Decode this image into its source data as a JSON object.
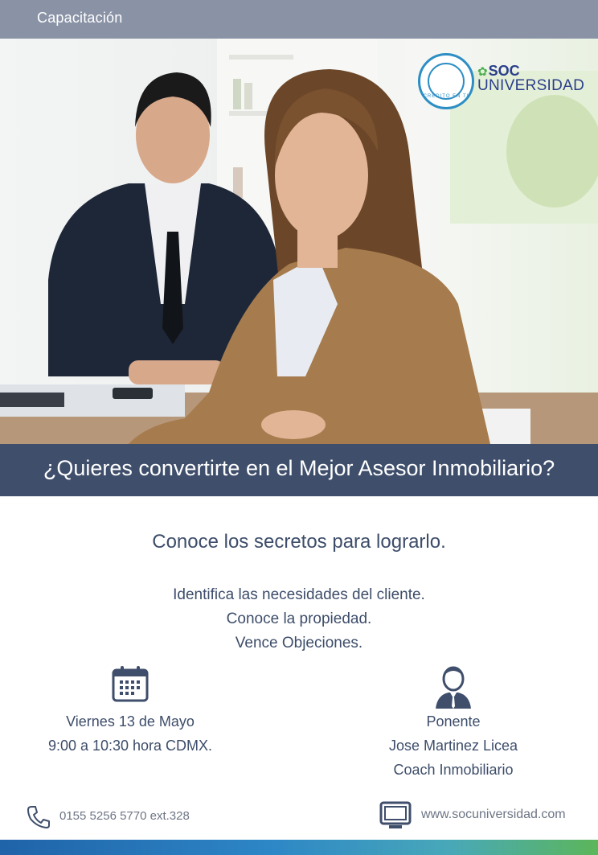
{
  "header": {
    "label": "Capacitación"
  },
  "logo": {
    "brand": "SOC",
    "sub": "UNIVERSIDAD",
    "seal_text": "CRÉDITO EN TI"
  },
  "headline": "¿Quieres convertirte en el Mejor Asesor Inmobiliario?",
  "subtitle": "Conoce los secretos para lograrlo.",
  "bullets": [
    "Identifica las necesidades del cliente.",
    "Conoce la propiedad.",
    "Vence Objeciones."
  ],
  "event": {
    "icon": "calendar-icon",
    "date": "Viernes 13 de Mayo",
    "time": "9:00 a 10:30 hora CDMX."
  },
  "speaker": {
    "icon": "person-icon",
    "title": "Ponente",
    "name": "Jose Martinez Licea",
    "role": "Coach Inmobiliario"
  },
  "contact": {
    "phone": "0155 5256 5770 ext.328",
    "website": "www.socuniversidad.com"
  },
  "colors": {
    "topbar": "#8a93a6",
    "headline_bar": "#3f4e6b",
    "text": "#3d4d6a",
    "brand_blue": "#2a3e8a",
    "brand_green": "#4caf50"
  }
}
